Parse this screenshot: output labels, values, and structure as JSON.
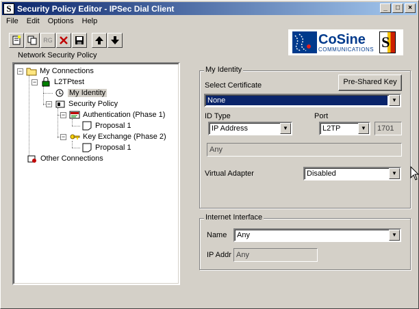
{
  "window": {
    "title": "Security Policy Editor - IPSec Dial Client",
    "app_icon_letter": "S",
    "controls": {
      "minimize": "_",
      "maximize": "□",
      "close": "×"
    }
  },
  "menu": [
    {
      "label": "File"
    },
    {
      "label": "Edit"
    },
    {
      "label": "Options"
    },
    {
      "label": "Help"
    }
  ],
  "toolbar": {
    "items": [
      {
        "icon": "new-connection-icon"
      },
      {
        "icon": "copy-icon"
      },
      {
        "icon": "rg-icon",
        "text": "RG"
      },
      {
        "icon": "delete-icon"
      },
      {
        "icon": "save-icon"
      },
      {
        "icon": "move-up-icon"
      },
      {
        "icon": "move-down-icon"
      }
    ]
  },
  "logo": {
    "name": "CoSine",
    "sub": "COMMUNICATIONS",
    "badge": "S"
  },
  "tree": {
    "label": "Network Security Policy",
    "nodes": {
      "my_connections": "My Connections",
      "l2tptest": "L2TPtest",
      "my_identity": "My Identity",
      "security_policy": "Security Policy",
      "auth_phase1": "Authentication (Phase 1)",
      "proposal1_a": "Proposal 1",
      "key_exchange": "Key Exchange (Phase 2)",
      "proposal1_b": "Proposal 1",
      "other_connections": "Other Connections"
    },
    "expanders": {
      "minus": "−"
    }
  },
  "identity": {
    "group_title": "My Identity",
    "select_certificate_label": "Select Certificate",
    "pre_shared_key_button": "Pre-Shared Key",
    "certificate_value": "None",
    "id_type_label": "ID Type",
    "id_type_value": "IP Address",
    "port_label": "Port",
    "port_value": "L2TP",
    "port_number": "1701",
    "any_value": "Any",
    "virtual_adapter_label": "Virtual Adapter",
    "virtual_adapter_value": "Disabled"
  },
  "internet": {
    "group_title": "Internet Interface",
    "name_label": "Name",
    "name_value": "Any",
    "ip_addr_label": "IP Addr",
    "ip_addr_value": "Any"
  },
  "combo_arrow": "▼",
  "colors": {
    "title_start": "#0a246a",
    "title_end": "#a6caf0",
    "face": "#d4d0c8",
    "selection": "#0a246a"
  }
}
